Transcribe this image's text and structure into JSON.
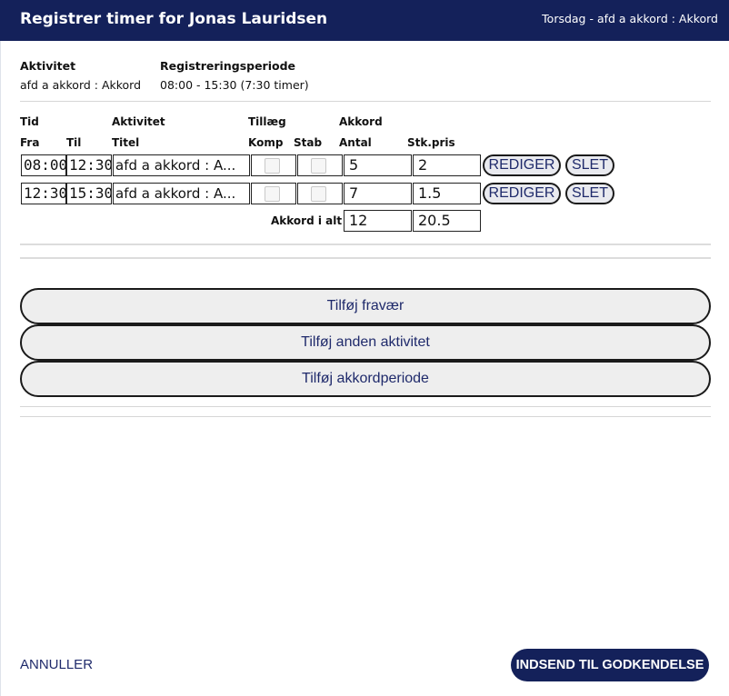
{
  "header": {
    "title": "Registrer timer for Jonas Lauridsen",
    "subtitle": "Torsdag - afd a akkord : Akkord"
  },
  "info": {
    "aktivitet_label": "Aktivitet",
    "aktivitet_value": "afd a akkord : Akkord",
    "periode_label": "Registreringsperiode",
    "periode_value": "08:00 - 15:30 (7:30 timer)"
  },
  "table": {
    "group_headers": {
      "tid": "Tid",
      "aktivitet": "Aktivitet",
      "tillaeg": "Tillæg",
      "akkord": "Akkord"
    },
    "columns": {
      "fra": "Fra",
      "til": "Til",
      "titel": "Titel",
      "komp": "Komp",
      "stab": "Stab",
      "antal": "Antal",
      "stkpris": "Stk.pris"
    },
    "rows": [
      {
        "fra": "08:00",
        "til": "12:30",
        "titel": "afd a akkord : A...",
        "komp": false,
        "stab": false,
        "antal": "5",
        "stkpris": "2",
        "edit": "REDIGER",
        "delete": "SLET"
      },
      {
        "fra": "12:30",
        "til": "15:30",
        "titel": "afd a akkord : A...",
        "komp": false,
        "stab": false,
        "antal": "7",
        "stkpris": "1.5",
        "edit": "REDIGER",
        "delete": "SLET"
      }
    ],
    "total_label": "Akkord i alt",
    "total_antal": "12",
    "total_stkpris": "20.5"
  },
  "actions": {
    "add_absence": "Tilføj fravær",
    "add_other_activity": "Tilføj anden aktivitet",
    "add_piecework_period": "Tilføj akkordperiode"
  },
  "footer": {
    "cancel": "ANNULLER",
    "submit": "INDSEND TIL GODKENDELSE"
  }
}
